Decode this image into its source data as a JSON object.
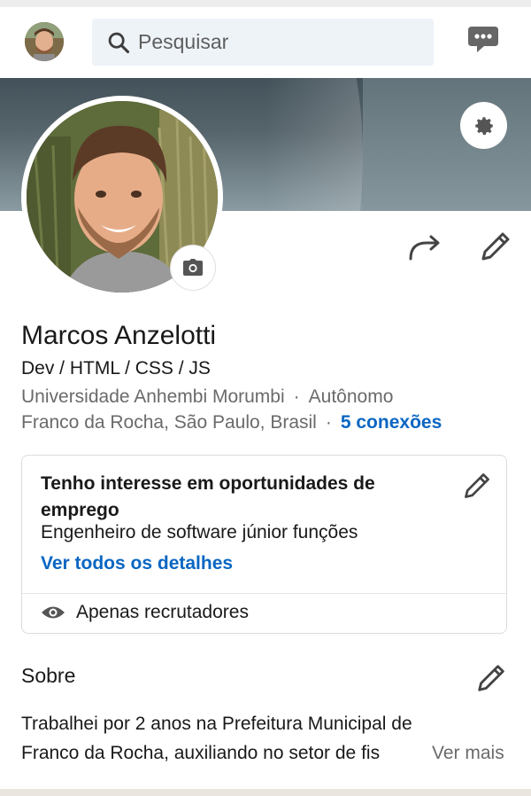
{
  "search": {
    "placeholder": "Pesquisar"
  },
  "icons": {
    "search": "search-icon",
    "messages": "chat-bubble-icon",
    "settings": "gear-icon",
    "camera": "camera-icon",
    "share": "share-arrow-icon",
    "edit": "pencil-icon",
    "visibility": "eye-icon"
  },
  "profile": {
    "name": "Marcos Anzelotti",
    "headline": "Dev / HTML / CSS / JS",
    "education": "Universidade Anhembi Morumbi",
    "company": "Autônomo",
    "location": "Franco da Rocha, São Paulo, Brasil",
    "connections": "5 conexões",
    "separator": "·"
  },
  "open_to_work": {
    "title": "Tenho interesse em oportunidades de emprego",
    "roles": "Engenheiro de software júnior funções",
    "details_link": "Ver todos os detalhes",
    "visibility": "Apenas recrutadores"
  },
  "about": {
    "title": "Sobre",
    "text": "Trabalhei por 2 anos na Prefeitura Municipal de Franco da Rocha, auxiliando no setor de fis",
    "see_more": "Ver mais"
  },
  "colors": {
    "link": "#0a66c2",
    "secondary_text": "#6a6a6a",
    "primary_text": "#191919",
    "search_bg": "#eef3f8"
  }
}
